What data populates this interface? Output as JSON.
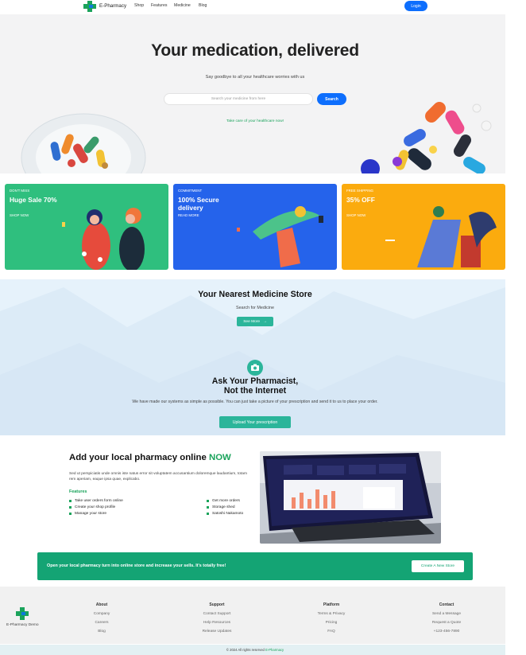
{
  "nav": {
    "brand": "E-Pharmacy",
    "links": [
      "Shop",
      "Features",
      "Medicine",
      "Blog"
    ],
    "login": "Login"
  },
  "hero": {
    "title": "Your medication, delivered",
    "subtitle": "Say goodbye to all your healthcare worries with us",
    "search_placeholder": "Search your medicine from here",
    "search_button": "Search",
    "tagline": "Take care of your healthcare now!"
  },
  "promos": [
    {
      "tag": "DON'T MISS",
      "title": "Huge Sale 70%",
      "link": "SHOP NOW",
      "color": "#2fbf7e"
    },
    {
      "tag": "COMMITMENT",
      "title": "100% Secure delivery",
      "link": "READ MORE",
      "color": "#2563eb"
    },
    {
      "tag": "FREE SHIPPING",
      "title": "35% OFF",
      "link": "SHOP NOW",
      "color": "#fbab0e"
    }
  ],
  "store": {
    "title": "Your Nearest Medicine Store",
    "subtitle": "Search for Medicine",
    "button": "See More",
    "ask_title_1": "Ask Your Pharmacist,",
    "ask_title_2": "Not the Internet",
    "ask_desc": "We have made our systems as simple as possible. You can just take a picture of your prescription and send it to us to place your order.",
    "upload_button": "Upload Your prescription"
  },
  "add_pharmacy": {
    "title": "Add your local pharmacy online",
    "title_highlight": "NOW",
    "desc": "Sed ut perspiciatis unde omnis iste natus error sit voluptatem accusantium doloremque laudantium, totam rem aperiam, eaque ipsa quae, explicabo.",
    "features_heading": "Features",
    "features_left": [
      "Take user orders form online",
      "Create your shop profile",
      "Manage your store"
    ],
    "features_right": [
      "Get more orders",
      "Storage shed",
      "Satoshi Nakamoto"
    ]
  },
  "cta": {
    "text": "Open your local pharmacy turn into online store and increase your sells. It's totally free!",
    "button": "Create A New Store"
  },
  "footer": {
    "brand": "E-Pharmacy Demo",
    "columns": [
      {
        "heading": "About",
        "items": [
          "Company",
          "Careers",
          "Blog"
        ]
      },
      {
        "heading": "Support",
        "items": [
          "Contact Support",
          "Help Resources",
          "Release Updates"
        ]
      },
      {
        "heading": "Platform",
        "items": [
          "Terms & Privacy",
          "Pricing",
          "FAQ"
        ]
      },
      {
        "heading": "Contact",
        "items": [
          "Send a Message",
          "Request a Quote",
          "+123-456-7890"
        ]
      }
    ],
    "copyright": "© 2024 All rights reserved",
    "copyright_brand": "E-Pharmacy"
  },
  "colors": {
    "primary": "#0d6efd",
    "green": "#1aa35b",
    "teal": "#2bb59a"
  }
}
